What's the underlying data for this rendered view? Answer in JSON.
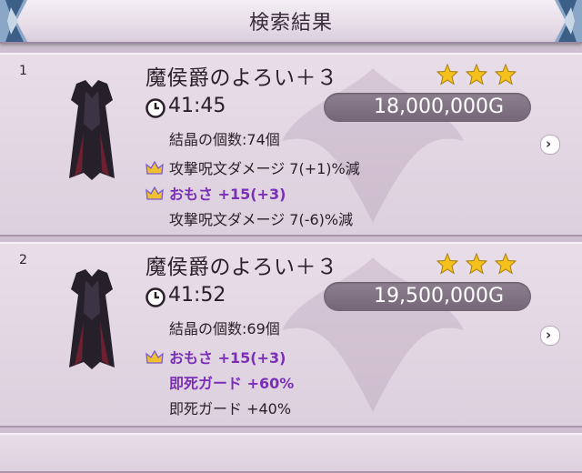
{
  "header": {
    "title": "検索結果"
  },
  "results": [
    {
      "rank": "1",
      "name": "魔侯爵のよろい＋３",
      "time": "41:45",
      "price": "18,000,000G",
      "crystal": "結晶の個数:74個",
      "effects": [
        {
          "text": "攻撃呪文ダメージ 7(+1)%減",
          "style": "normal",
          "icon": "crown-icon"
        },
        {
          "text": "おもさ +15(+3)",
          "style": "purple",
          "icon": "crown-icon"
        },
        {
          "text": "攻撃呪文ダメージ 7(-6)%減",
          "style": "normal",
          "icon": ""
        }
      ]
    },
    {
      "rank": "2",
      "name": "魔侯爵のよろい＋３",
      "time": "41:52",
      "price": "19,500,000G",
      "crystal": "結晶の個数:69個",
      "effects": [
        {
          "text": "おもさ +15(+3)",
          "style": "purple",
          "icon": "crown-icon"
        },
        {
          "text": "即死ガード +60%",
          "style": "purple",
          "icon": ""
        },
        {
          "text": "即死ガード +40%",
          "style": "normal",
          "icon": ""
        }
      ]
    }
  ],
  "colors": {
    "star": "#f4c21b",
    "purple": "#7a2fb6",
    "price_box": "#7d6f7f"
  },
  "arrow_icon": "chevron-right-icon"
}
